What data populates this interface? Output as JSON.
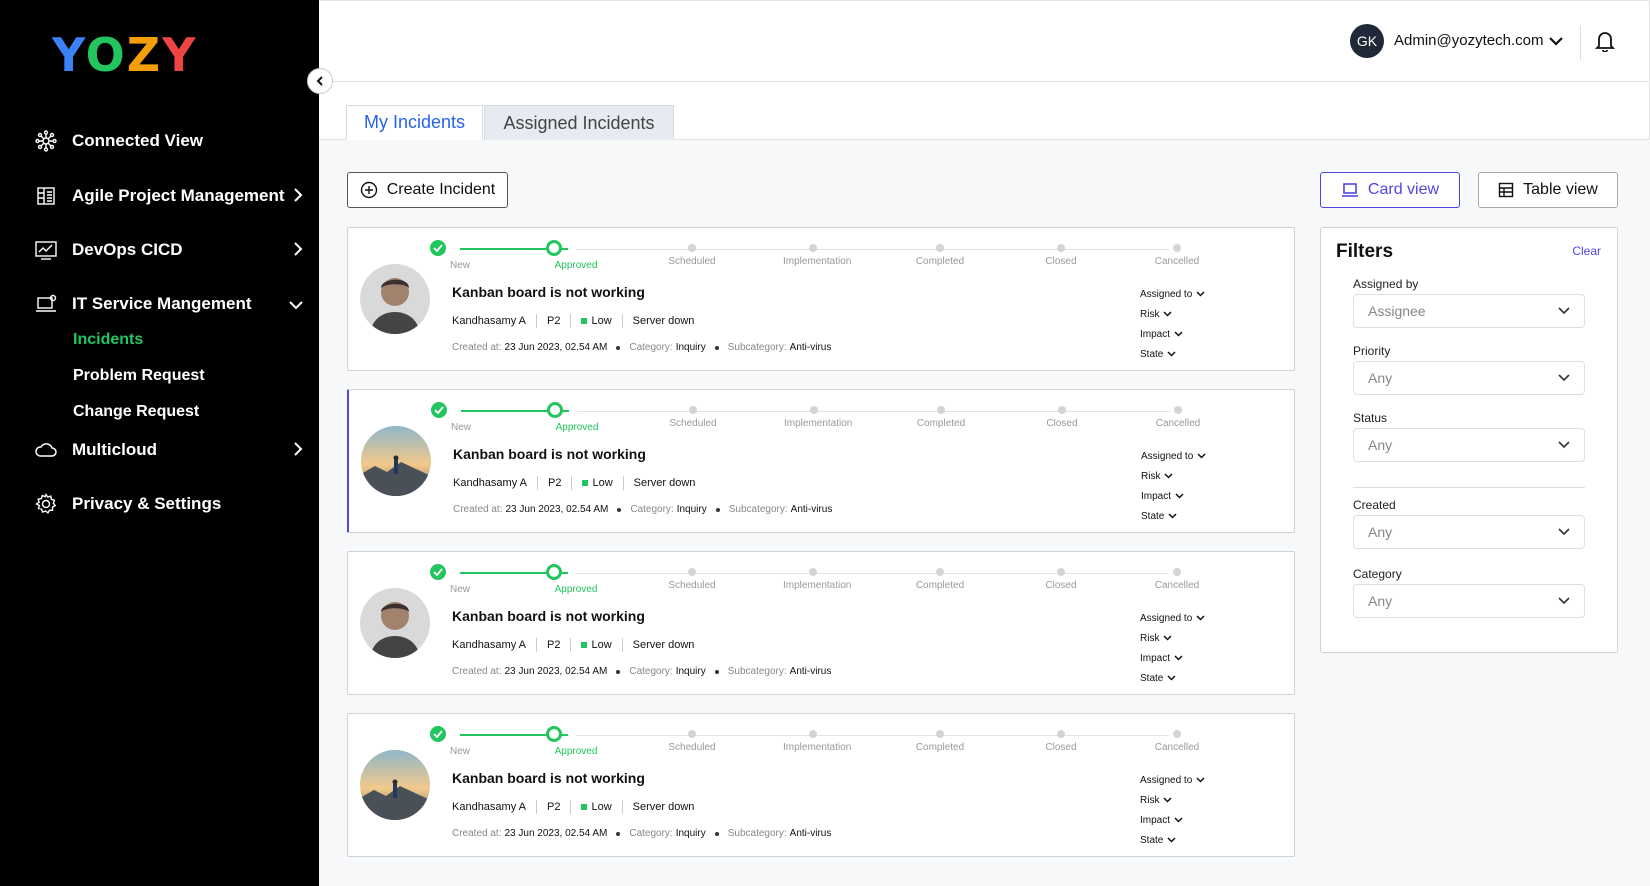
{
  "brand": {
    "logo_letters": [
      "Y",
      "O",
      "Z",
      "Y"
    ],
    "logo_colors": [
      "#3b82f6",
      "#22c55e",
      "#f59e0b",
      "#ef4444"
    ]
  },
  "sidebar": {
    "items": [
      {
        "label": "Connected View",
        "icon": "hub-icon"
      },
      {
        "label": "Agile Project Management",
        "icon": "board-icon"
      },
      {
        "label": "DevOps CICD",
        "icon": "pipeline-icon"
      },
      {
        "label": "IT Service Mangement",
        "icon": "laptop-gear-icon"
      },
      {
        "label": "Multicloud",
        "icon": "cloud-icon"
      },
      {
        "label": "Privacy & Settings",
        "icon": "gear-icon"
      }
    ],
    "sub_items": [
      "Incidents",
      "Problem Request",
      "Change Request"
    ],
    "active_sub": "Incidents"
  },
  "header": {
    "avatar_initials": "GK",
    "user_email": "Admin@yozytech.com"
  },
  "tabs": [
    {
      "label": "My Incidents",
      "active": true
    },
    {
      "label": "Assigned Incidents",
      "active": false
    }
  ],
  "toolbar": {
    "create_label": "Create Incident",
    "card_view_label": "Card view",
    "table_view_label": "Table view"
  },
  "stages": [
    "New",
    "Approved",
    "Scheduled",
    "Implementation",
    "Completed",
    "Closed",
    "Cancelled"
  ],
  "incidents": [
    {
      "title": "Kanban board is not working",
      "assignee": "Kandhasamy A",
      "priority": "P2",
      "level": "Low",
      "issue": "Server down",
      "created_label": "Created at:",
      "created": "23 Jun 2023, 02.54 AM",
      "category_label": "Category:",
      "category": "Inquiry",
      "subcategory_label": "Subcategory:",
      "subcategory": "Anti-virus",
      "photo": "man-portrait",
      "current_stage_index": 1
    },
    {
      "title": "Kanban board is not working",
      "assignee": "Kandhasamy A",
      "priority": "P2",
      "level": "Low",
      "issue": "Server down",
      "created_label": "Created at:",
      "created": "23 Jun 2023, 02.54 AM",
      "category_label": "Category:",
      "category": "Inquiry",
      "subcategory_label": "Subcategory:",
      "subcategory": "Anti-virus",
      "photo": "sunset-landscape",
      "current_stage_index": 1
    },
    {
      "title": "Kanban board is not working",
      "assignee": "Kandhasamy A",
      "priority": "P2",
      "level": "Low",
      "issue": "Server down",
      "created_label": "Created at:",
      "created": "23 Jun 2023, 02.54 AM",
      "category_label": "Category:",
      "category": "Inquiry",
      "subcategory_label": "Subcategory:",
      "subcategory": "Anti-virus",
      "photo": "man-portrait",
      "current_stage_index": 1
    },
    {
      "title": "Kanban board is not working",
      "assignee": "Kandhasamy A",
      "priority": "P2",
      "level": "Low",
      "issue": "Server down",
      "created_label": "Created at:",
      "created": "23 Jun 2023, 02.54 AM",
      "category_label": "Category:",
      "category": "Inquiry",
      "subcategory_label": "Subcategory:",
      "subcategory": "Anti-virus",
      "photo": "sunset-landscape",
      "current_stage_index": 1
    }
  ],
  "card_actions": [
    "Assigned to",
    "Risk",
    "Impact",
    "State"
  ],
  "filters": {
    "title": "Filters",
    "clear_label": "Clear",
    "fields": [
      {
        "label": "Assigned by",
        "value": "Assignee"
      },
      {
        "label": "Priority",
        "value": "Any"
      },
      {
        "label": "Status",
        "value": "Any"
      },
      {
        "label": "Created",
        "value": "Any"
      },
      {
        "label": "Category",
        "value": "Any"
      }
    ]
  },
  "colors": {
    "accent": "#4f46e5",
    "success": "#22c55e",
    "sidebar_bg": "#000000"
  }
}
